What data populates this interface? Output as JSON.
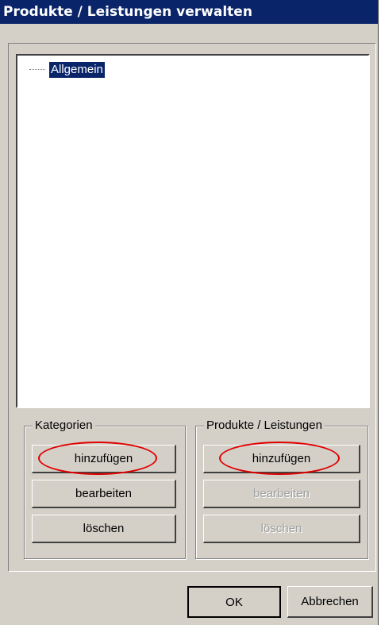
{
  "window": {
    "title": "Produkte / Leistungen verwalten"
  },
  "tree": {
    "nodes": [
      {
        "label": "Allgemein",
        "selected": true
      }
    ]
  },
  "kategorien": {
    "title": "Kategorien",
    "add_label": "hinzufügen",
    "edit_label": "bearbeiten",
    "delete_label": "löschen"
  },
  "produkte": {
    "title": "Produkte / Leistungen",
    "add_label": "hinzufügen",
    "edit_label": "bearbeiten",
    "delete_label": "löschen",
    "edit_disabled": true,
    "delete_disabled": true
  },
  "footer": {
    "ok_label": "OK",
    "cancel_label": "Abbrechen"
  },
  "colors": {
    "title_bar": "#0a246a",
    "face": "#d4d0c8",
    "highlight_ellipse": "#e00000"
  }
}
